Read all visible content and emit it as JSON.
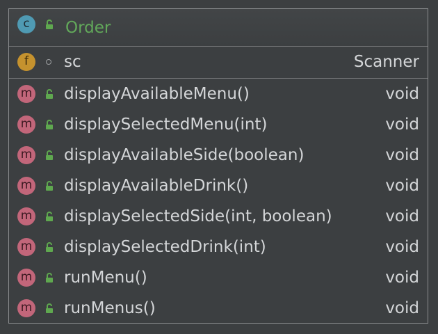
{
  "class": {
    "badge": "c",
    "name": "Order",
    "badge_color": "#4f9ab3",
    "title_color": "#62a85a",
    "visibility_icon": "unlocked-public-icon"
  },
  "fields": [
    {
      "badge": "f",
      "name": "sc",
      "type": "Scanner",
      "visibility_icon": "package-private-dot-icon"
    }
  ],
  "methods": [
    {
      "badge": "m",
      "name": "displayAvailableMenu()",
      "type": "void",
      "visibility_icon": "unlocked-public-icon"
    },
    {
      "badge": "m",
      "name": "displaySelectedMenu(int)",
      "type": "void",
      "visibility_icon": "unlocked-public-icon"
    },
    {
      "badge": "m",
      "name": "displayAvailableSide(boolean)",
      "type": "void",
      "visibility_icon": "unlocked-public-icon"
    },
    {
      "badge": "m",
      "name": "displayAvailableDrink()",
      "type": "void",
      "visibility_icon": "unlocked-public-icon"
    },
    {
      "badge": "m",
      "name": "displaySelectedSide(int, boolean)",
      "type": "void",
      "visibility_icon": "unlocked-public-icon"
    },
    {
      "badge": "m",
      "name": "displaySelectedDrink(int)",
      "type": "void",
      "visibility_icon": "unlocked-public-icon"
    },
    {
      "badge": "m",
      "name": "runMenu()",
      "type": "void",
      "visibility_icon": "unlocked-public-icon"
    },
    {
      "badge": "m",
      "name": "runMenus()",
      "type": "void",
      "visibility_icon": "unlocked-public-icon"
    }
  ],
  "colors": {
    "background": "#3c3f41",
    "text": "#d4d6d8",
    "field_badge": "#c5922e",
    "method_badge": "#c2667a",
    "public_icon": "#5fa84f"
  }
}
